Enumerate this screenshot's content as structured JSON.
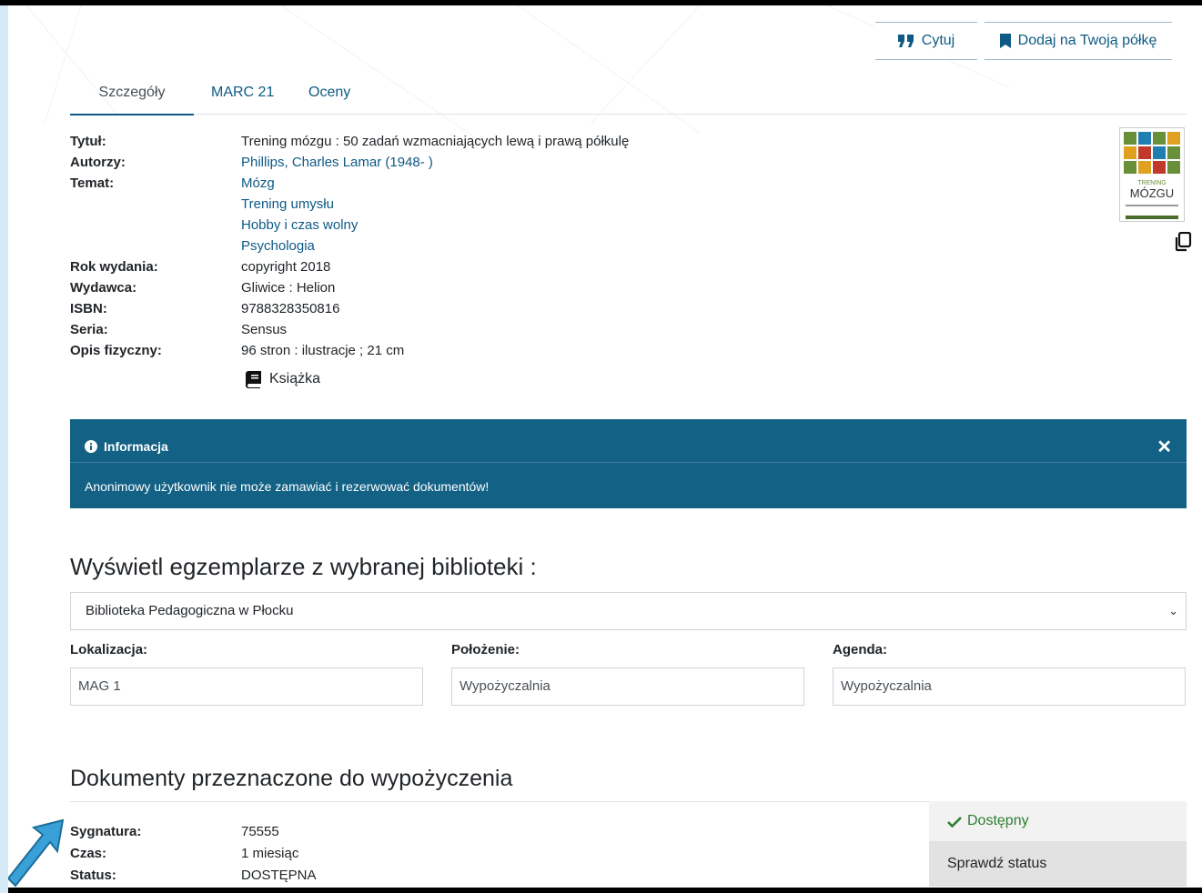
{
  "actions": {
    "cite_label": "Cytuj",
    "add_shelf_label": "Dodaj na Twoją półkę"
  },
  "tabs": [
    {
      "label": "Szczegóły",
      "active": true
    },
    {
      "label": "MARC 21",
      "active": false
    },
    {
      "label": "Oceny",
      "active": false
    }
  ],
  "details": {
    "title_label": "Tytuł:",
    "title": "Trening mózgu : 50 zadań wzmacniających lewą i prawą półkulę",
    "authors_label": "Autorzy:",
    "authors": [
      "Phillips, Charles Lamar (1948- )"
    ],
    "subject_label": "Temat:",
    "subjects": [
      "Mózg",
      "Trening umysłu",
      "Hobby i czas wolny",
      "Psychologia"
    ],
    "year_label": "Rok wydania:",
    "year": "copyright 2018",
    "publisher_label": "Wydawca:",
    "publisher": "Gliwice : Helion",
    "isbn_label": "ISBN:",
    "isbn": "9788328350816",
    "series_label": "Seria:",
    "series": "Sensus",
    "physical_label": "Opis fizyczny:",
    "physical": "96 stron : ilustracje ; 21 cm",
    "doc_type": "Książka"
  },
  "cover": {
    "title_line1": "TRENING",
    "title_line2": "MÓZGU"
  },
  "info": {
    "heading": "Informacja",
    "message": "Anonimowy użytkownik nie może zamawiać i rezerwować dokumentów!",
    "color": "#136185"
  },
  "copies": {
    "heading": "Wyświetl egzemplarze z wybranej biblioteki :",
    "library_selected": "Biblioteka Pedagogiczna w Płocku",
    "location_label": "Lokalizacja:",
    "location": "MAG 1",
    "position_label": "Położenie:",
    "position": "Wypożyczalnia",
    "agenda_label": "Agenda:",
    "agenda": "Wypożyczalnia"
  },
  "loan_docs": {
    "heading": "Dokumenty przeznaczone do wypożyczenia",
    "signature_label": "Sygnatura:",
    "signature": "75555",
    "time_label": "Czas:",
    "time": "1 miesiąc",
    "status_label": "Status:",
    "status": "DOSTĘPNA",
    "availability": "Dostępny",
    "check_status": "Sprawdź status"
  },
  "colors": {
    "accent": "#0e5a85",
    "available": "#2e7d32",
    "frame": "#d4eaf7"
  }
}
